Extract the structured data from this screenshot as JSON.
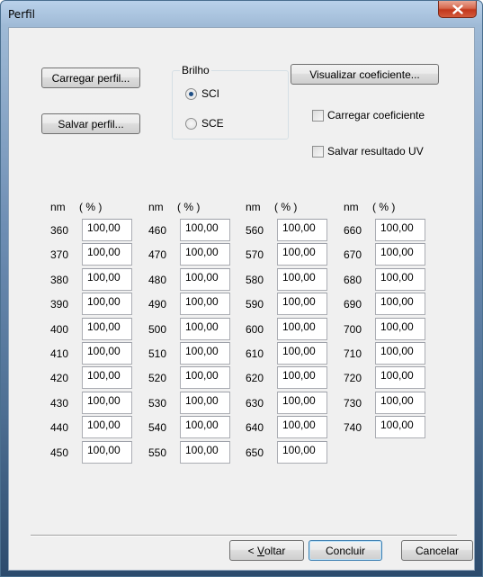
{
  "window": {
    "title": "Perfil"
  },
  "buttons": {
    "load_profile": "Carregar perfil...",
    "save_profile": "Salvar perfil...",
    "view_coefficient": "Visualizar coeficiente...",
    "back_prefix": "< ",
    "back_accel": "V",
    "back_rest": "oltar",
    "finish": "Concluir",
    "cancel": "Cancelar"
  },
  "brightness": {
    "label": "Brilho",
    "options": [
      {
        "label": "SCI",
        "selected": true
      },
      {
        "label": "SCE",
        "selected": false
      }
    ]
  },
  "checkboxes": {
    "load_coefficient": {
      "label": "Carregar coeficiente",
      "checked": false
    },
    "save_uv_result": {
      "label": "Salvar resultado UV",
      "checked": false
    }
  },
  "table": {
    "header_nm": "nm",
    "header_pct": "( % )",
    "columns": [
      {
        "rows": [
          {
            "nm": "360",
            "value": "100,00"
          },
          {
            "nm": "370",
            "value": "100,00"
          },
          {
            "nm": "380",
            "value": "100,00"
          },
          {
            "nm": "390",
            "value": "100,00"
          },
          {
            "nm": "400",
            "value": "100,00"
          },
          {
            "nm": "410",
            "value": "100,00"
          },
          {
            "nm": "420",
            "value": "100,00"
          },
          {
            "nm": "430",
            "value": "100,00"
          },
          {
            "nm": "440",
            "value": "100,00"
          },
          {
            "nm": "450",
            "value": "100,00"
          }
        ]
      },
      {
        "rows": [
          {
            "nm": "460",
            "value": "100,00"
          },
          {
            "nm": "470",
            "value": "100,00"
          },
          {
            "nm": "480",
            "value": "100,00"
          },
          {
            "nm": "490",
            "value": "100,00"
          },
          {
            "nm": "500",
            "value": "100,00"
          },
          {
            "nm": "510",
            "value": "100,00"
          },
          {
            "nm": "520",
            "value": "100,00"
          },
          {
            "nm": "530",
            "value": "100,00"
          },
          {
            "nm": "540",
            "value": "100,00"
          },
          {
            "nm": "550",
            "value": "100,00"
          }
        ]
      },
      {
        "rows": [
          {
            "nm": "560",
            "value": "100,00"
          },
          {
            "nm": "570",
            "value": "100,00"
          },
          {
            "nm": "580",
            "value": "100,00"
          },
          {
            "nm": "590",
            "value": "100,00"
          },
          {
            "nm": "600",
            "value": "100,00"
          },
          {
            "nm": "610",
            "value": "100,00"
          },
          {
            "nm": "620",
            "value": "100,00"
          },
          {
            "nm": "630",
            "value": "100,00"
          },
          {
            "nm": "640",
            "value": "100,00"
          },
          {
            "nm": "650",
            "value": "100,00"
          }
        ]
      },
      {
        "rows": [
          {
            "nm": "660",
            "value": "100,00"
          },
          {
            "nm": "670",
            "value": "100,00"
          },
          {
            "nm": "680",
            "value": "100,00"
          },
          {
            "nm": "690",
            "value": "100,00"
          },
          {
            "nm": "700",
            "value": "100,00"
          },
          {
            "nm": "710",
            "value": "100,00"
          },
          {
            "nm": "720",
            "value": "100,00"
          },
          {
            "nm": "730",
            "value": "100,00"
          },
          {
            "nm": "740",
            "value": "100,00"
          }
        ]
      }
    ]
  },
  "icons": {
    "close": "close-icon"
  },
  "colors": {
    "title_bar": "#9fbad6",
    "close_button": "#c2371b",
    "client_bg": "#f0f0f0"
  }
}
